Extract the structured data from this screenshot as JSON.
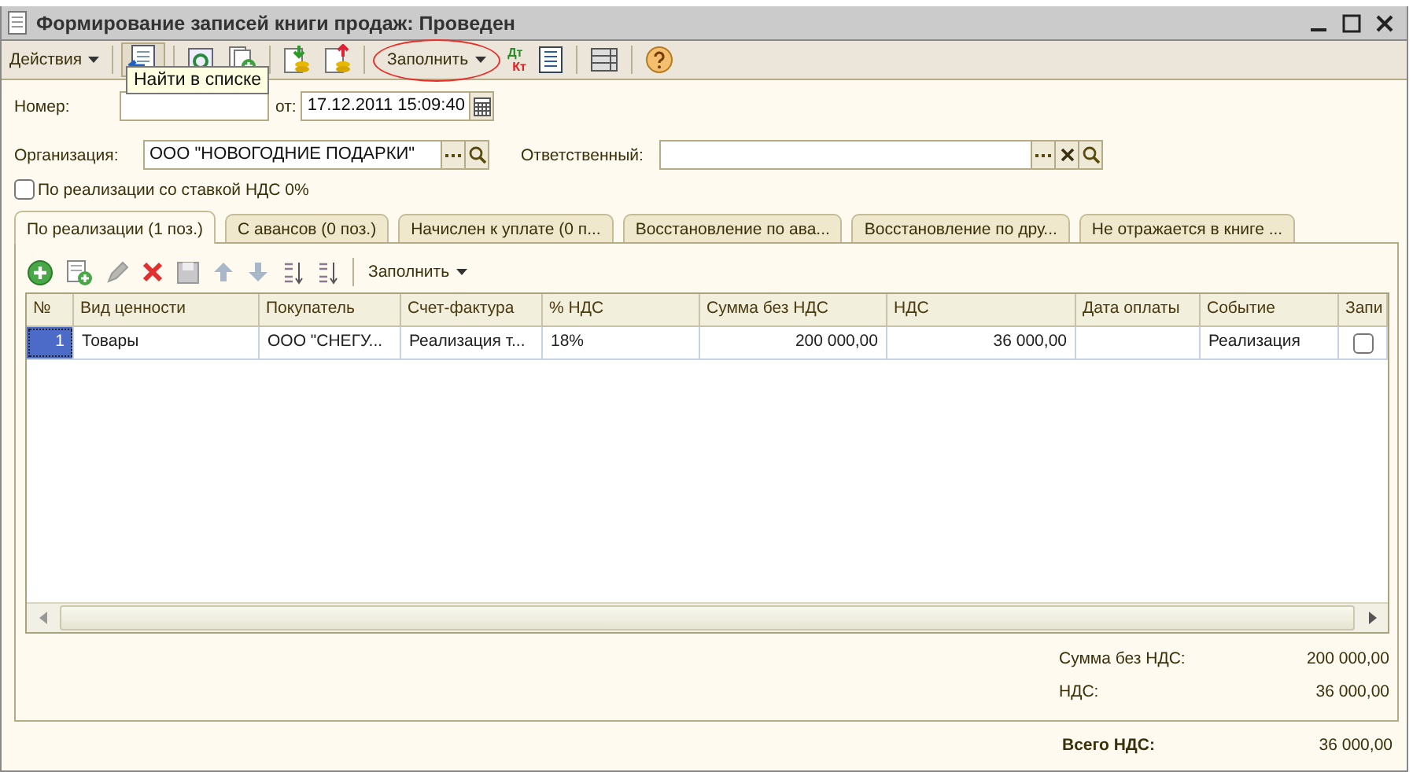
{
  "window": {
    "title": "Формирование записей книги продаж: Проведен"
  },
  "toolbar": {
    "actions_menu": "Действия",
    "fill_button": "Заполнить",
    "fill_highlighted": true,
    "posting_debit": "Дт",
    "posting_credit": "Кт"
  },
  "tooltip": "Найти в списке",
  "form": {
    "number_label": "Номер:",
    "date_label": "от:",
    "date_value": "17.12.2011 15:09:40",
    "org_label": "Организация:",
    "org_value": "ООО \"НОВОГОДНИЕ ПОДАРКИ\"",
    "responsible_label": "Ответственный:",
    "zero_rate": {
      "label": "По реализации со ставкой НДС 0%",
      "checked": false
    }
  },
  "tabs": [
    {
      "label": "По реализации (1 поз.)",
      "selected": true
    },
    {
      "label": "С авансов (0 поз.)",
      "selected": false
    },
    {
      "label": "Начислен к уплате (0 п...",
      "selected": false
    },
    {
      "label": "Восстановление по ава...",
      "selected": false
    },
    {
      "label": "Восстановление по дру...",
      "selected": false
    },
    {
      "label": "Не отражается в книге ...",
      "selected": false
    }
  ],
  "table_toolbar": {
    "fill_button": "Заполнить"
  },
  "table": {
    "columns": [
      "№",
      "Вид ценности",
      "Покупатель",
      "Счет-фактура",
      "% НДС",
      "Сумма без НДС",
      "НДС",
      "Дата оплаты",
      "Событие",
      "Запи"
    ],
    "rows": [
      {
        "number": "1",
        "value_type": "Товары",
        "buyer": "ООО \"СНЕГУ...",
        "invoice": "Реализация т...",
        "vat_rate": "18%",
        "amount": "200 000,00",
        "vat": "36 000,00",
        "event": "Реализация",
        "recorded": false,
        "selected": true
      }
    ]
  },
  "totals": [
    {
      "label": "Сумма без НДС:",
      "value": "200 000,00"
    },
    {
      "label": "НДС:",
      "value": "36 000,00"
    }
  ],
  "grand_total": {
    "label": "Всего НДС:",
    "value": "36 000,00"
  }
}
